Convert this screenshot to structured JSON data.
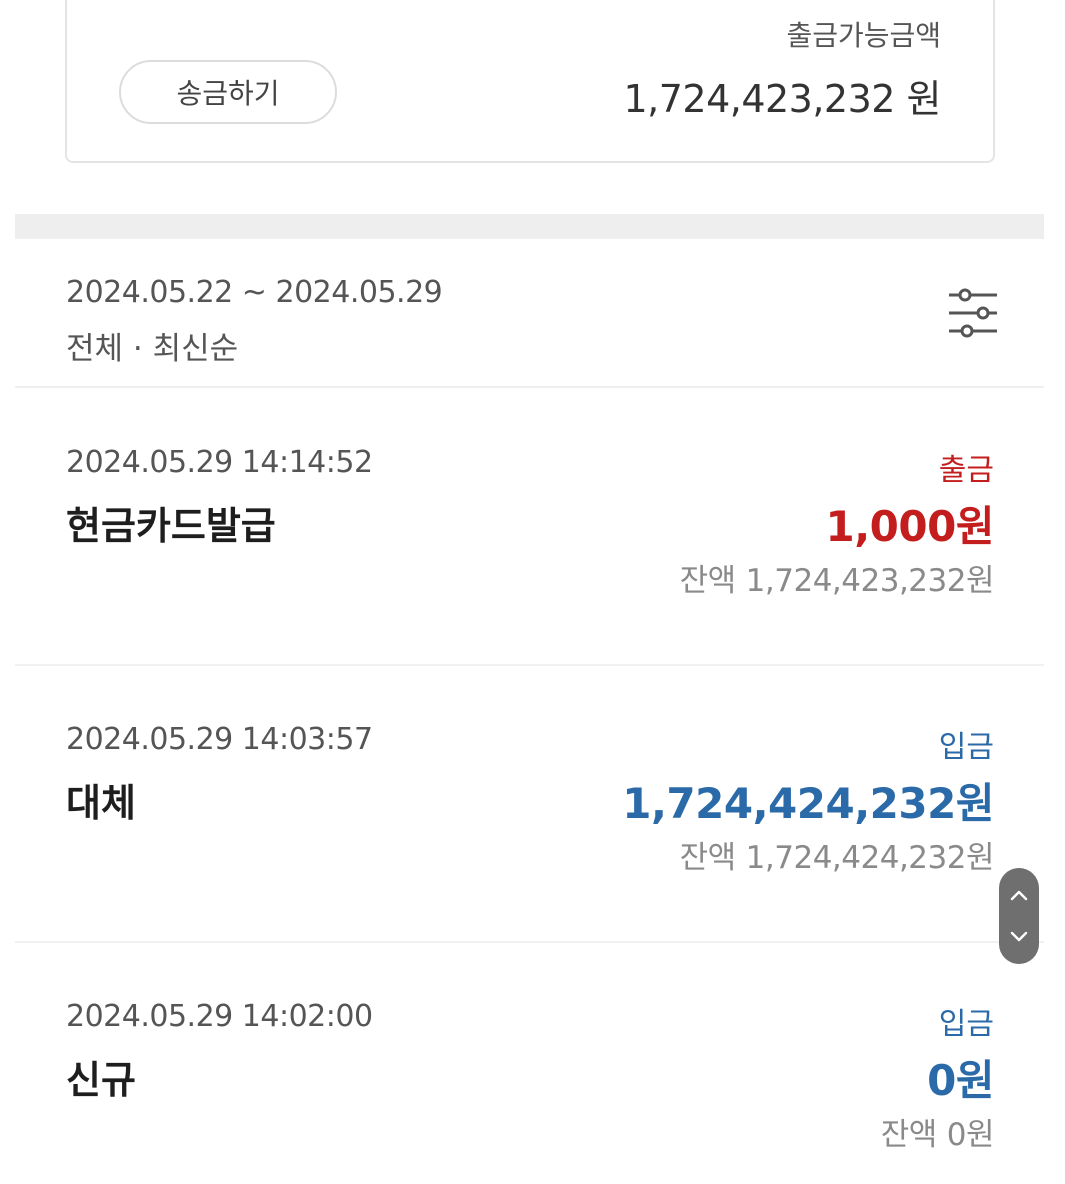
{
  "balance_card": {
    "send_button_label": "송금하기",
    "available_label": "출금가능금액",
    "available_amount": "1,724,423,232 원"
  },
  "filter": {
    "date_range": "2024.05.22 ~ 2024.05.29",
    "summary": "전체 · 최신순",
    "icon": "filter-sliders-icon"
  },
  "transactions": [
    {
      "datetime": "2024.05.29 14:14:52",
      "title": "현금카드발급",
      "type": "출금",
      "amount": "1,000원",
      "balance_label": "잔액",
      "balance_value": "1,724,423,232원",
      "color": "#c41d1d"
    },
    {
      "datetime": "2024.05.29 14:03:57",
      "title": "대체",
      "type": "입금",
      "amount": "1,724,424,232원",
      "balance_label": "잔액",
      "balance_value": "1,724,424,232원",
      "color": "#2b6aa8"
    },
    {
      "datetime": "2024.05.29 14:02:00",
      "title": "신규",
      "type": "입금",
      "amount": "0원",
      "balance_label": "잔액",
      "balance_value": "0원",
      "color": "#2b6aa8"
    }
  ],
  "scroll_control": {
    "up_icon": "chevron-up-icon",
    "down_icon": "chevron-down-icon"
  }
}
